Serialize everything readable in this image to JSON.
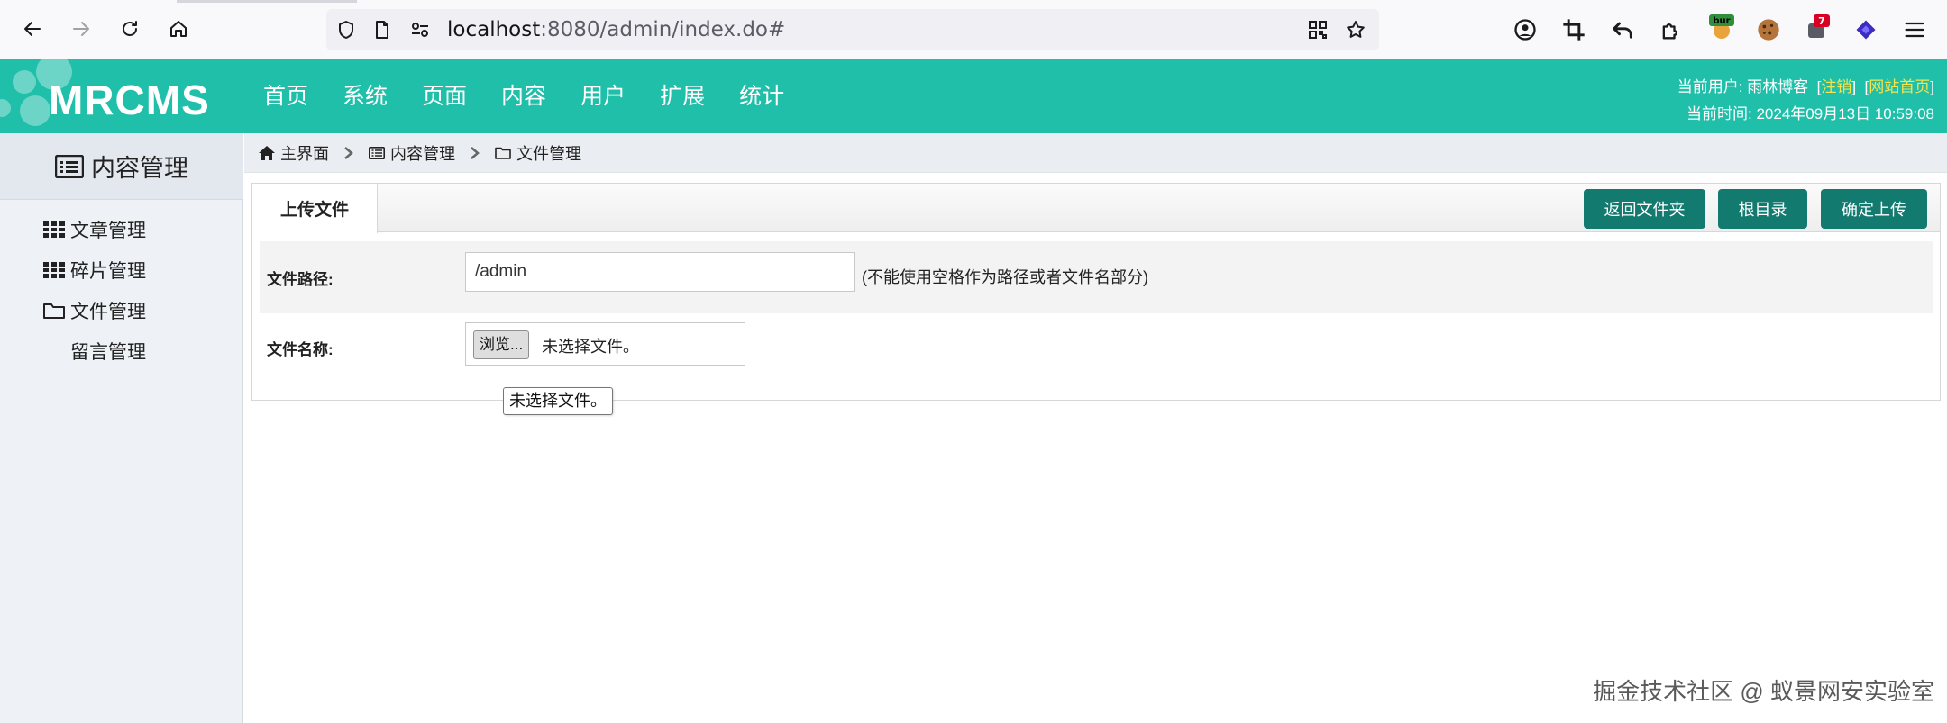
{
  "browser": {
    "url_host": "localhost",
    "url_rest": ":8080/admin/index.do#",
    "extensions": [
      "account-icon",
      "crop-icon",
      "undo-icon",
      "extensions-icon",
      "burp-extension-icon",
      "cookie-icon",
      "notification-extension-icon",
      "layers-extension-icon",
      "menu-icon"
    ],
    "burp_badge": "bur",
    "notify_badge": "7"
  },
  "header": {
    "logo": "MRCMS",
    "nav": [
      "首页",
      "系统",
      "页面",
      "内容",
      "用户",
      "扩展",
      "统计"
    ],
    "user_label": "当前用户: 雨林博客",
    "logout": "注销",
    "site_home": "网站首页",
    "time_label": "当前时间: 2024年09月13日 10:59:08",
    "bg_color": "#1fbfa9",
    "link_color": "#f7e34a"
  },
  "sidebar": {
    "title": "内容管理",
    "items": [
      {
        "label": "文章管理",
        "icon": "grid-icon"
      },
      {
        "label": "碎片管理",
        "icon": "grid-icon"
      },
      {
        "label": "文件管理",
        "icon": "folder-icon"
      },
      {
        "label": "留言管理",
        "icon": ""
      }
    ]
  },
  "breadcrumb": {
    "home": "主界面",
    "section": "内容管理",
    "page": "文件管理"
  },
  "panel": {
    "tab": "上传文件",
    "buttons": {
      "back": "返回文件夹",
      "root": "根目录",
      "confirm": "确定上传"
    },
    "path_label": "文件路径:",
    "path_value": "/admin",
    "path_hint": "(不能使用空格作为路径或者文件名部分)",
    "name_label": "文件名称:",
    "browse_label": "浏览...",
    "no_file": "未选择文件。",
    "tooltip": "未选择文件。",
    "button_color": "#137a70"
  },
  "watermark": "掘金技术社区 @ 蚁景网安实验室"
}
